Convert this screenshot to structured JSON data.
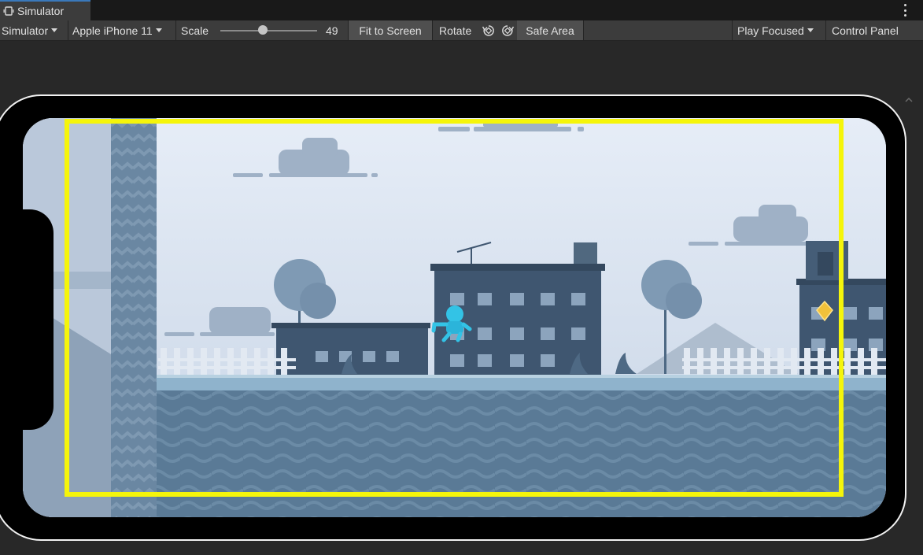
{
  "window": {
    "tab_label": "Simulator",
    "tab_icon": "device-simulator-icon"
  },
  "toolbar": {
    "mode_label": "Simulator",
    "device_label": "Apple iPhone 11",
    "scale_label": "Scale",
    "scale_value": "49",
    "fit_button": "Fit to Screen",
    "rotate_label": "Rotate",
    "rotate_left_icon": "rotate-left-icon",
    "rotate_right_icon": "rotate-right-icon",
    "safe_area_button": "Safe Area",
    "play_focused_label": "Play Focused",
    "control_panel_label": "Control Panel"
  },
  "colors": {
    "safe_area_outline": "#f5f50a",
    "tab_accent": "#3a79bb",
    "sky": "#dde6f3",
    "ground": "#5c7c97",
    "player": "#33c3e6",
    "gem": "#f2c13a"
  }
}
